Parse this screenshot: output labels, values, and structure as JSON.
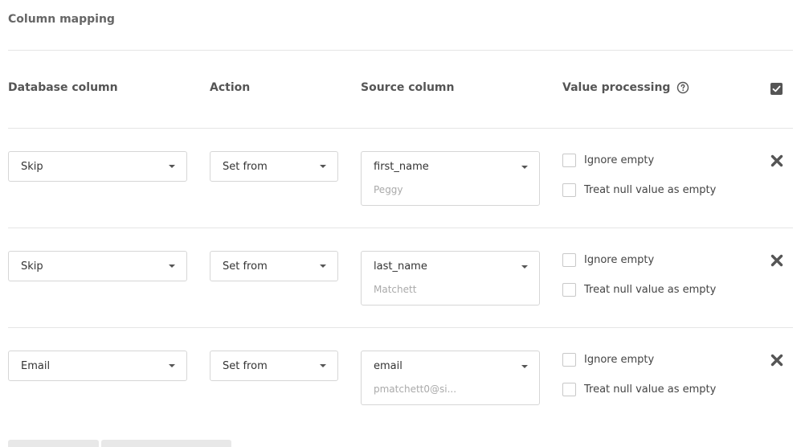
{
  "section": {
    "title": "Column mapping"
  },
  "headers": {
    "database_column": "Database column",
    "action": "Action",
    "source_column": "Source column",
    "value_processing": "Value processing"
  },
  "icons": {
    "help": "question-circle-icon",
    "remove": "close-x-icon",
    "select_all": "checkbox-checked-icon"
  },
  "colors": {
    "text": "#333333",
    "muted": "#aaaaaa",
    "border": "#d6d6d6",
    "icon": "#555555"
  },
  "rows": [
    {
      "database_column": "Skip",
      "action": "Set from",
      "source_column": "first_name",
      "source_sample": "Peggy",
      "ignore_empty_label": "Ignore empty",
      "treat_null_label": "Treat null value as empty",
      "ignore_empty": false,
      "treat_null": false
    },
    {
      "database_column": "Skip",
      "action": "Set from",
      "source_column": "last_name",
      "source_sample": "Matchett",
      "ignore_empty_label": "Ignore empty",
      "treat_null_label": "Treat null value as empty",
      "ignore_empty": false,
      "treat_null": false
    },
    {
      "database_column": "Email",
      "action": "Set from",
      "source_column": "email",
      "source_sample": "pmatchett0@si...",
      "ignore_empty_label": "Ignore empty",
      "treat_null_label": "Treat null value as empty",
      "ignore_empty": false,
      "treat_null": false
    }
  ]
}
